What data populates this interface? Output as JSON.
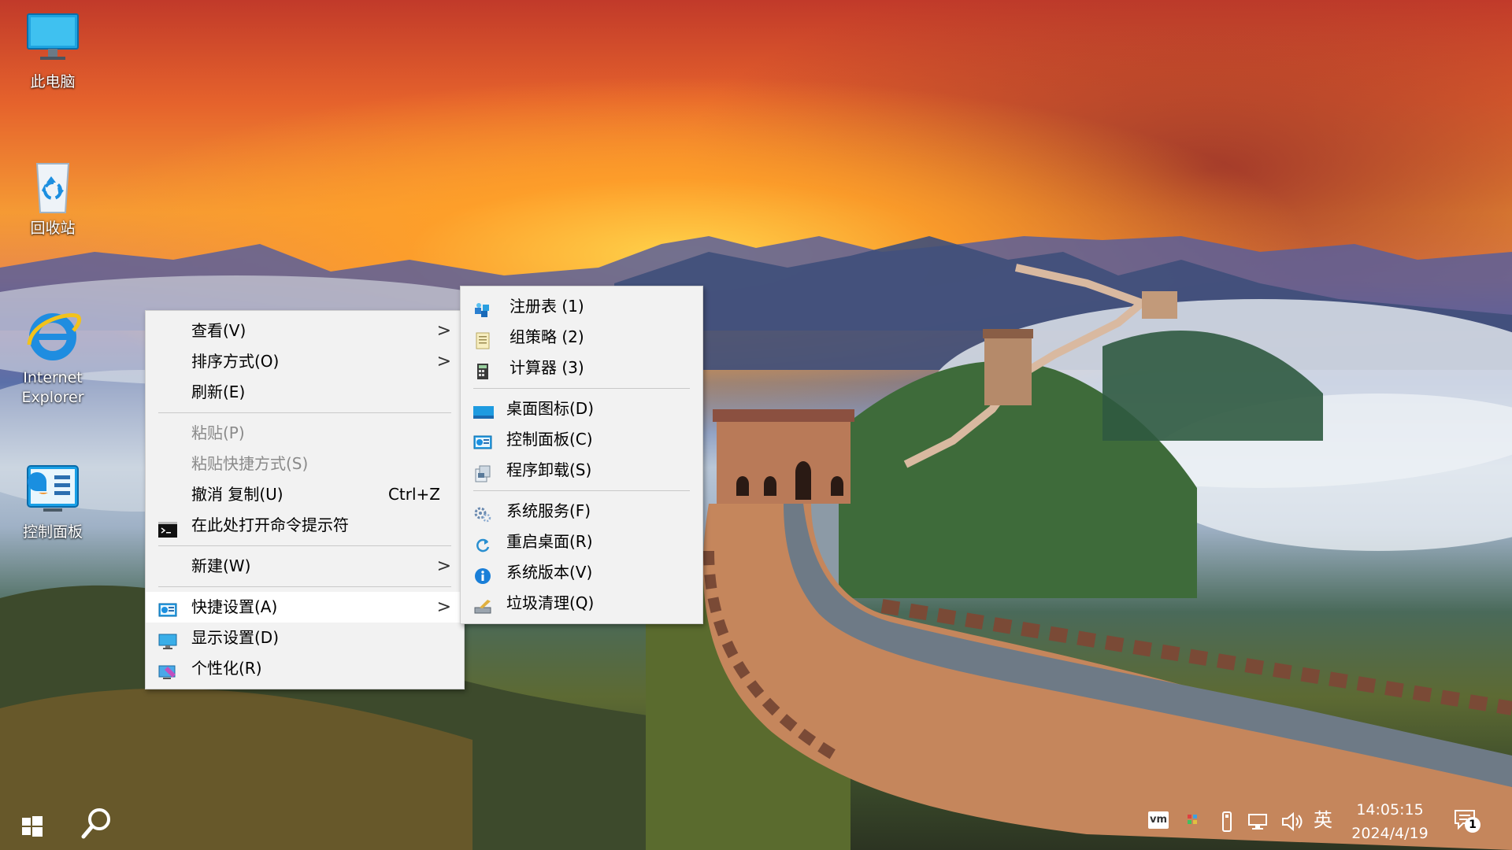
{
  "desktop_icons": [
    {
      "id": "this-pc",
      "label": "此电脑"
    },
    {
      "id": "recycle-bin",
      "label": "回收站"
    },
    {
      "id": "ie",
      "label": "Internet Explorer"
    },
    {
      "id": "control-panel",
      "label": "控制面板"
    }
  ],
  "context_menu": {
    "view": "查看(V)",
    "sort": "排序方式(O)",
    "refresh": "刷新(E)",
    "paste": "粘贴(P)",
    "paste_shortcut": "粘贴快捷方式(S)",
    "undo": "撤消 复制(U)",
    "undo_accel": "Ctrl+Z",
    "open_cmd": "在此处打开命令提示符",
    "new": "新建(W)",
    "quick_settings": "快捷设置(A)",
    "display_settings": "显示设置(D)",
    "personalize": "个性化(R)"
  },
  "submenu": {
    "regedit": "注册表  (1)",
    "gpedit": "组策略  (2)",
    "calc": "计算器  (3)",
    "desktop_icons": "桌面图标(D)",
    "control_panel": "控制面板(C)",
    "uninstall": "程序卸载(S)",
    "services": "系统服务(F)",
    "restart_desktop": "重启桌面(R)",
    "version": "系统版本(V)",
    "cleanup": "垃圾清理(Q)"
  },
  "taskbar": {
    "ime": "英",
    "time": "14:05:15",
    "date": "2024/4/19",
    "notification_count": "1",
    "vm_label": "vm"
  },
  "colors": {
    "menu_bg": "#f2f2f2",
    "menu_hover": "#ffffff",
    "disabled_text": "#8a8a8a"
  }
}
